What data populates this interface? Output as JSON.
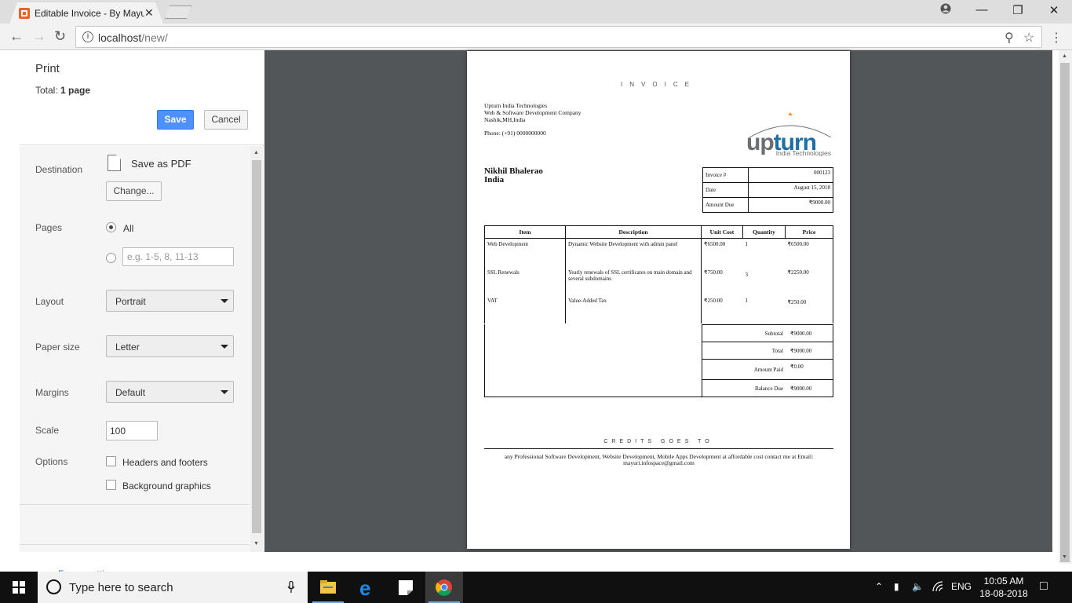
{
  "browser": {
    "tab_title": "Editable Invoice - By Mayuri",
    "tab_close": "✕",
    "url_host": "localhost",
    "url_path": "/new/",
    "back_icon": "arrow-left-icon",
    "forward_icon": "arrow-right-icon",
    "reload_icon": "reload-icon"
  },
  "print_panel": {
    "title": "Print",
    "total_label": "Total:",
    "total_value": "1 page",
    "save_label": "Save",
    "cancel_label": "Cancel",
    "destination_label": "Destination",
    "destination_value": "Save as PDF",
    "change_label": "Change...",
    "pages_label": "Pages",
    "pages_all": "All",
    "pages_placeholder": "e.g. 1-5, 8, 11-13",
    "layout_label": "Layout",
    "layout_value": "Portrait",
    "paper_label": "Paper size",
    "paper_value": "Letter",
    "margins_label": "Margins",
    "margins_value": "Default",
    "scale_label": "Scale",
    "scale_value": "100",
    "options_label": "Options",
    "option_headers": "Headers and footers",
    "option_background": "Background graphics",
    "fewer_settings": "Fewer settings"
  },
  "invoice": {
    "title": "INVOICE",
    "company_name": "Upturn India Technologies",
    "company_tagline": "Web & Software Development Company",
    "company_address": "Nashik,MH,India",
    "phone": "Phone: (+91) 0000000000",
    "logo_word": "upturn",
    "logo_sub": "India Technologies",
    "client_name": "Nikhil Bhalerao",
    "client_country": "India",
    "meta": [
      {
        "label": "Invoice #",
        "value": "000123"
      },
      {
        "label": "Date",
        "value": "August 15, 2018"
      },
      {
        "label": "Amount Due",
        "value": "₹9000.00"
      }
    ],
    "columns": [
      "Item",
      "Description",
      "Unit Cost",
      "Quantity",
      "Price"
    ],
    "rows": [
      {
        "item": "Web Development",
        "description": "Dynamic Website Development with admin panel",
        "unit_cost": "₹6500.00",
        "quantity": "1",
        "price": "₹6500.00"
      },
      {
        "item": "SSL Renewals",
        "description": "Yearly renewals of SSL certificates on main domain and several subdomains",
        "unit_cost": "₹750.00",
        "quantity": "3",
        "price": "₹2250.00"
      },
      {
        "item": "VAT",
        "description": "Value-Added Tax",
        "unit_cost": "₹250.00",
        "quantity": "1",
        "price": "₹250.00"
      }
    ],
    "totals": [
      {
        "label": "Subtotal",
        "value": "₹9000.00"
      },
      {
        "label": "Total",
        "value": "₹9000.00"
      },
      {
        "label": "Amount Paid",
        "value": "₹0.00"
      },
      {
        "label": "Balance Due",
        "value": "₹9000.00"
      }
    ],
    "credits_title": "CREDITS GOES TO",
    "credits_text": "any Professional Software Development, Website Development, Mobile Apps Development at affordable cost contact me at Email: mayuri.infospace@gmail.com"
  },
  "taskbar": {
    "search_placeholder": "Type here to search",
    "language": "ENG",
    "time": "10:05 AM",
    "date": "18-08-2018"
  },
  "colors": {
    "save_button": "#4d90fe",
    "preview_background": "#525659",
    "logo_blue": "#1e6fa6",
    "logo_gray": "#6d6e71",
    "logo_orange": "#f7941d"
  }
}
